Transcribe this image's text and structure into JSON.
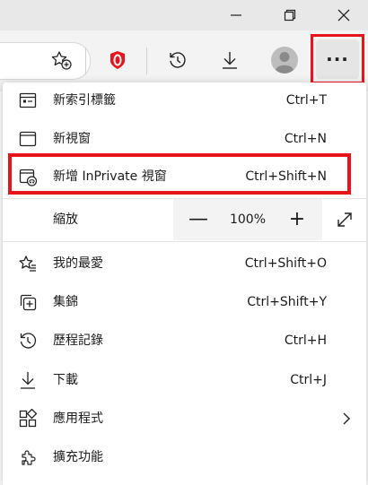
{
  "window": {
    "minimize_icon": "minimize-icon",
    "restore_icon": "restore-icon",
    "close_icon": "close-icon"
  },
  "toolbar": {
    "icons": [
      "favorite-add-icon",
      "opera-extension-icon",
      "history-icon",
      "download-icon",
      "profile-avatar-icon"
    ],
    "more_label": "···"
  },
  "menu": {
    "items_top": [
      {
        "label": "新索引標籤",
        "shortcut": "Ctrl+T",
        "icon": "new-tab-icon"
      },
      {
        "label": "新視窗",
        "shortcut": "Ctrl+N",
        "icon": "new-window-icon"
      },
      {
        "label": "新增 InPrivate 視窗",
        "shortcut": "Ctrl+Shift+N",
        "icon": "inprivate-window-icon"
      }
    ],
    "zoom": {
      "label": "縮放",
      "minus": "—",
      "value": "100%",
      "plus": "+"
    },
    "items_bottom": [
      {
        "label": "我的最愛",
        "shortcut": "Ctrl+Shift+O",
        "icon": "favorites-icon"
      },
      {
        "label": "集錦",
        "shortcut": "Ctrl+Shift+Y",
        "icon": "collections-icon"
      },
      {
        "label": "歷程記錄",
        "shortcut": "Ctrl+H",
        "icon": "history-icon"
      },
      {
        "label": "下載",
        "shortcut": "Ctrl+J",
        "icon": "download-icon"
      },
      {
        "label": "應用程式",
        "shortcut": "",
        "icon": "apps-icon"
      },
      {
        "label": "擴充功能",
        "shortcut": "",
        "icon": "extensions-icon"
      }
    ]
  },
  "colors": {
    "highlight": "#e8141c",
    "opera_red": "#e8141c"
  }
}
